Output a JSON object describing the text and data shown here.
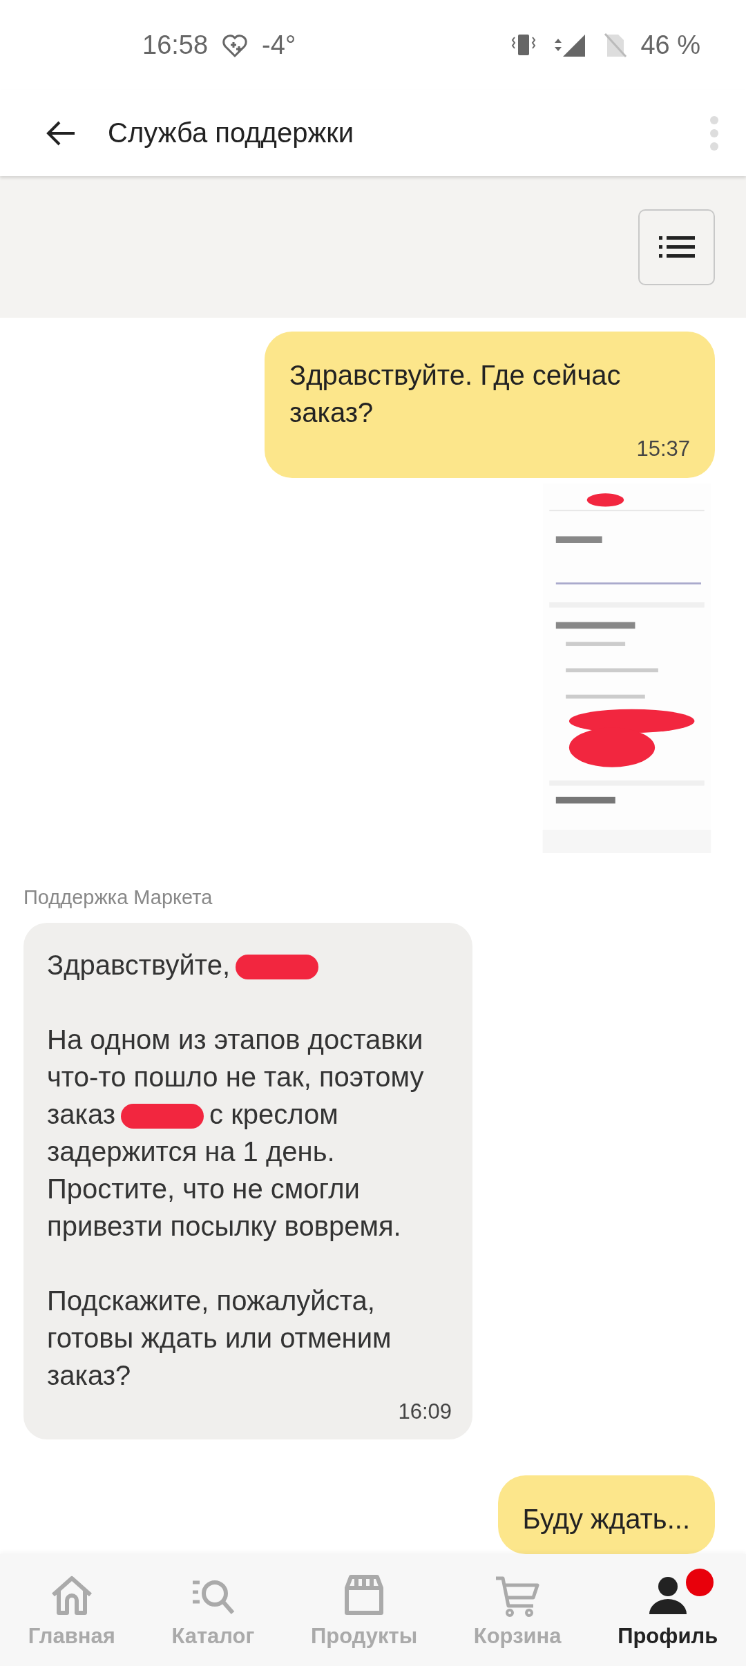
{
  "status_bar": {
    "time": "16:58",
    "weather": "-4°",
    "battery": "46 %"
  },
  "header": {
    "title": "Служба поддержки"
  },
  "messages": [
    {
      "kind": "outgoing",
      "text": "Здравствуйте. Где сейчас заказ?",
      "time": "15:37"
    },
    {
      "kind": "picture"
    },
    {
      "kind": "incoming",
      "sender": "Поддержка Маркета",
      "time": "16:09",
      "paragraphs": [
        [
          {
            "kind": "text",
            "text": "Здравствуйте,"
          },
          {
            "kind": "redaction"
          }
        ],
        [
          {
            "kind": "text",
            "text": "На одном из этапов доставки что-то пошло не так, поэтому заказ"
          },
          {
            "kind": "redaction"
          },
          {
            "kind": "text",
            "text": "с креслом задержится на 1 день. Простите, что не смогли привезти посылку вовремя."
          }
        ],
        [
          {
            "kind": "text",
            "text": "Подскажите, пожалуйста, готовы ждать или отменим заказ?"
          }
        ]
      ]
    },
    {
      "kind": "outgoing",
      "text": "Буду ждать..."
    }
  ],
  "nav": [
    {
      "label": "Главная",
      "selected": false
    },
    {
      "label": "Каталог",
      "selected": false
    },
    {
      "label": "Продукты",
      "selected": false
    },
    {
      "label": "Корзина",
      "selected": false
    },
    {
      "label": "Профиль",
      "selected": true,
      "badge": true
    }
  ]
}
